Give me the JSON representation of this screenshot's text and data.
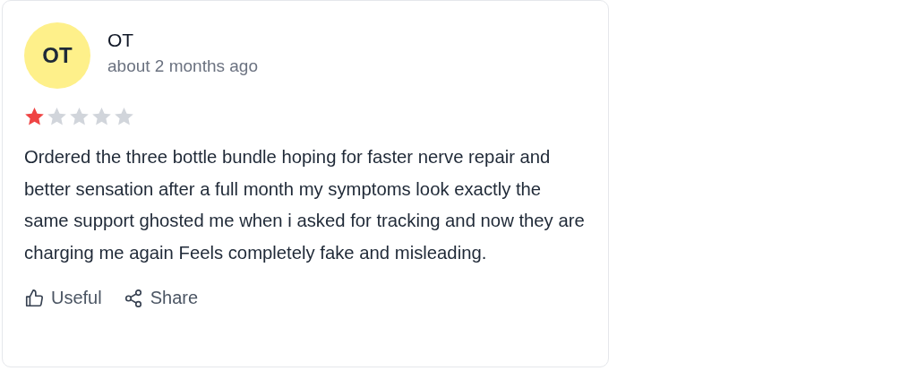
{
  "review": {
    "avatar_initials": "OT",
    "author": "OT",
    "time": "about 2 months ago",
    "stars": 1,
    "text": "Ordered the three bottle bundle hoping for faster nerve repair and better sensation after a full month my symptoms look exactly the same support ghosted me when i asked for tracking and now they are charging me again Feels completely fake and misleading.",
    "actions": [
      {
        "kind": "useful",
        "label": "Useful"
      },
      {
        "kind": "share",
        "label": "Share"
      }
    ]
  }
}
